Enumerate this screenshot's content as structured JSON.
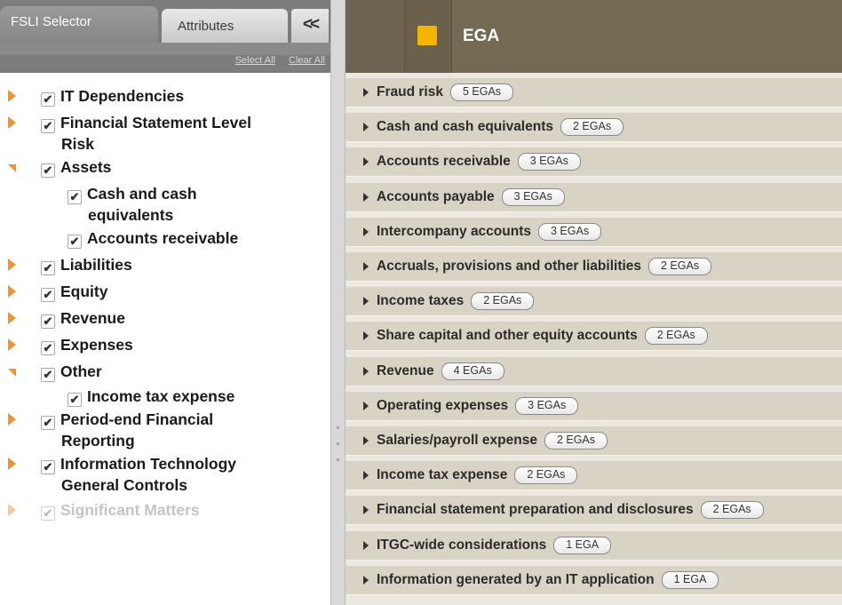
{
  "left_panel": {
    "tabs": {
      "fsli": "FSLI Selector",
      "attributes": "Attributes",
      "collapse": "<<"
    },
    "links": {
      "select_all": "Select All",
      "clear_all": "Clear All"
    },
    "tree": [
      {
        "label": "IT Dependencies",
        "level": 0,
        "expanded": false,
        "checked": true
      },
      {
        "label": "Financial Statement Level",
        "label2": "Risk",
        "level": 0,
        "expanded": false,
        "checked": true
      },
      {
        "label": "Assets",
        "level": 0,
        "expanded": true,
        "checked": true
      },
      {
        "label": "Cash and cash",
        "label2": "equivalents",
        "level": 1,
        "checked": true
      },
      {
        "label": "Accounts receivable",
        "level": 1,
        "checked": true
      },
      {
        "label": "Liabilities",
        "level": 0,
        "expanded": false,
        "checked": true
      },
      {
        "label": "Equity",
        "level": 0,
        "expanded": false,
        "checked": true
      },
      {
        "label": "Revenue",
        "level": 0,
        "expanded": false,
        "checked": true
      },
      {
        "label": "Expenses",
        "level": 0,
        "expanded": false,
        "checked": true
      },
      {
        "label": "Other",
        "level": 0,
        "expanded": true,
        "checked": true
      },
      {
        "label": "Income tax expense",
        "level": 1,
        "checked": true
      },
      {
        "label": "Period-end Financial",
        "label2": "Reporting",
        "level": 0,
        "expanded": false,
        "checked": true
      },
      {
        "label": "Information Technology",
        "label2": "General Controls",
        "level": 0,
        "expanded": false,
        "checked": true
      },
      {
        "label": "Significant Matters",
        "level": 0,
        "expanded": false,
        "checked": true,
        "disabled": true
      }
    ]
  },
  "right_panel": {
    "title": "EGA",
    "badge_color": "#f5b400",
    "rows": [
      {
        "label": "Fraud risk",
        "count": "5 EGAs"
      },
      {
        "label": "Cash and cash equivalents",
        "count": "2 EGAs"
      },
      {
        "label": "Accounts receivable",
        "count": "3 EGAs"
      },
      {
        "label": "Accounts payable",
        "count": "3 EGAs"
      },
      {
        "label": "Intercompany accounts",
        "count": "3 EGAs"
      },
      {
        "label": "Accruals, provisions and other liabilities",
        "count": "2 EGAs"
      },
      {
        "label": "Income taxes",
        "count": "2 EGAs"
      },
      {
        "label": "Share capital and other equity accounts",
        "count": "2 EGAs"
      },
      {
        "label": "Revenue",
        "count": "4 EGAs"
      },
      {
        "label": "Operating expenses",
        "count": "3 EGAs"
      },
      {
        "label": "Salaries/payroll expense",
        "count": "2 EGAs"
      },
      {
        "label": "Income tax expense",
        "count": "2 EGAs"
      },
      {
        "label": "Financial statement preparation and disclosures",
        "count": "2 EGAs"
      },
      {
        "label": "ITGC-wide considerations",
        "count": "1 EGA"
      },
      {
        "label": "Information generated by an IT application",
        "count": "1 EGA"
      }
    ]
  },
  "colors": {
    "accent_arrow": "#f0922d",
    "header_bg": "#746a53",
    "row_bg": "#d9d3c5"
  }
}
